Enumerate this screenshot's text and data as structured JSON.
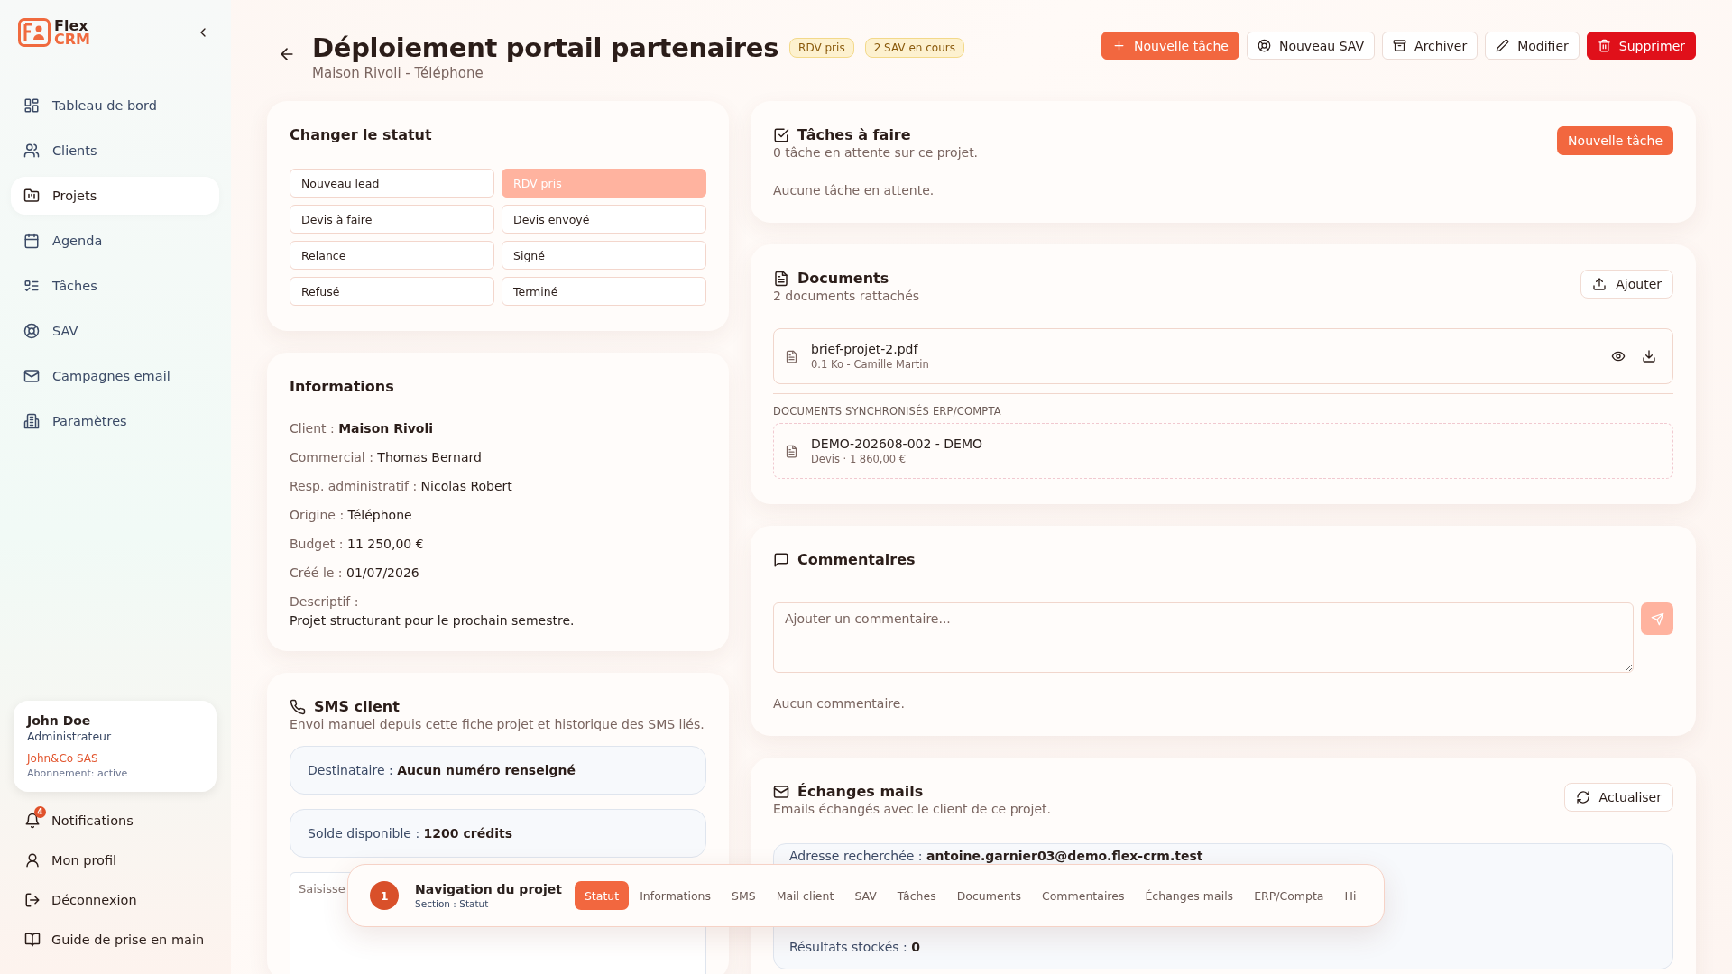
{
  "sidebar": {
    "logo": {
      "word_1": "Flex",
      "word_2": "CRM"
    },
    "nav_items": [
      {
        "label": "Tableau de bord",
        "kind": "dashboard",
        "selected": false
      },
      {
        "label": "Clients",
        "kind": "users",
        "selected": false
      },
      {
        "label": "Projets",
        "kind": "folder",
        "selected": true
      },
      {
        "label": "Agenda",
        "kind": "calendar",
        "selected": false
      },
      {
        "label": "Tâches",
        "kind": "tasks",
        "selected": false
      },
      {
        "label": "SAV",
        "kind": "lifebuoy",
        "selected": false
      },
      {
        "label": "Campagnes email",
        "kind": "mail",
        "selected": false
      },
      {
        "label": "Paramètres",
        "kind": "building",
        "selected": false
      }
    ],
    "user": {
      "name": "John Doe",
      "role": "Administrateur",
      "company": "John&Co SAS",
      "subscription": "Abonnement: active"
    },
    "footer_items": [
      {
        "label": "Notifications",
        "kind": "bell",
        "badge": "4"
      },
      {
        "label": "Mon profil",
        "kind": "user"
      },
      {
        "label": "Déconnexion",
        "kind": "logout"
      },
      {
        "label": "Guide de prise en main",
        "kind": "book"
      }
    ]
  },
  "header": {
    "title": "Déploiement portail partenaires",
    "badges": [
      "RDV pris",
      "2 SAV en cours"
    ],
    "subtitle": "Maison Rivoli - Téléphone",
    "actions": [
      {
        "label": "Nouvelle tâche",
        "kind": "primary"
      },
      {
        "label": "Nouveau SAV",
        "kind": "outline"
      },
      {
        "label": "Archiver",
        "kind": "outline"
      },
      {
        "label": "Modifier",
        "kind": "outline"
      },
      {
        "label": "Supprimer",
        "kind": "danger"
      }
    ]
  },
  "status_card": {
    "title": "Changer le statut",
    "options": [
      {
        "label": "Nouveau lead",
        "selected": false
      },
      {
        "label": "RDV pris",
        "selected": true
      },
      {
        "label": "Devis à faire",
        "selected": false
      },
      {
        "label": "Devis envoyé",
        "selected": false
      },
      {
        "label": "Relance",
        "selected": false
      },
      {
        "label": "Signé",
        "selected": false
      },
      {
        "label": "Refusé",
        "selected": false
      },
      {
        "label": "Terminé",
        "selected": false
      }
    ]
  },
  "info_card": {
    "title": "Informations",
    "fields": [
      {
        "label": "Client :",
        "value": "Maison Rivoli",
        "bold": true
      },
      {
        "label": "Commercial :",
        "value": "Thomas Bernard",
        "bold": false
      },
      {
        "label": "Resp. administratif :",
        "value": "Nicolas Robert",
        "bold": false
      },
      {
        "label": "Origine :",
        "value": "Téléphone",
        "bold": false
      },
      {
        "label": "Budget :",
        "value": "11 250,00 €",
        "bold": false
      },
      {
        "label": "Créé le :",
        "value": "01/07/2026",
        "bold": false
      }
    ],
    "description_label": "Descriptif :",
    "description": "Projet structurant pour le prochain semestre."
  },
  "sms_card": {
    "title": "SMS client",
    "subtitle": "Envoi manuel depuis cette fiche projet et historique des SMS liés.",
    "recipient": {
      "label": "Destinataire :",
      "value": "Aucun numéro renseigné"
    },
    "balance": {
      "label": "Solde disponible :",
      "value": "1200 crédits"
    },
    "message": {
      "placeholder": "Saisisse"
    }
  },
  "tasks_card": {
    "title": "Tâches à faire",
    "subtitle": "0 tâche en attente sur ce projet.",
    "button": "Nouvelle tâche",
    "empty": "Aucune tâche en attente."
  },
  "documents_card": {
    "title": "Documents",
    "subtitle": "2 documents rattachés",
    "button": "Ajouter",
    "files": [
      {
        "name": "brief-projet-2.pdf",
        "meta": "0.1 Ko - Camille Martin"
      }
    ],
    "sync_heading": "DOCUMENTS SYNCHRONISÉS ERP/COMPTA",
    "synced": [
      {
        "name": "DEMO-202608-002 - DEMO",
        "meta": "Devis · 1 860,00 €"
      }
    ]
  },
  "comments_card": {
    "title": "Commentaires",
    "placeholder": "Ajouter un commentaire...",
    "empty": "Aucun commentaire."
  },
  "mails_card": {
    "title": "Échanges mails",
    "subtitle": "Emails échangés avec le client de ce projet.",
    "button": "Actualiser",
    "search": {
      "label": "Adresse recherchée :",
      "value": "antoine.garnier03@demo.flex-crm.test"
    },
    "stored": {
      "label": "Résultats stockés :",
      "value": "0"
    }
  },
  "project_nav": {
    "step": "1",
    "title": "Navigation du projet",
    "section": "Section : Statut",
    "tabs": [
      {
        "label": "Statut",
        "selected": true
      },
      {
        "label": "Informations",
        "selected": false
      },
      {
        "label": "SMS",
        "selected": false
      },
      {
        "label": "Mail client",
        "selected": false
      },
      {
        "label": "SAV",
        "selected": false
      },
      {
        "label": "Tâches",
        "selected": false
      },
      {
        "label": "Documents",
        "selected": false
      },
      {
        "label": "Commentaires",
        "selected": false
      },
      {
        "label": "Échanges mails",
        "selected": false
      },
      {
        "label": "ERP/Compta",
        "selected": false
      },
      {
        "label": "Hi",
        "selected": false
      }
    ]
  }
}
